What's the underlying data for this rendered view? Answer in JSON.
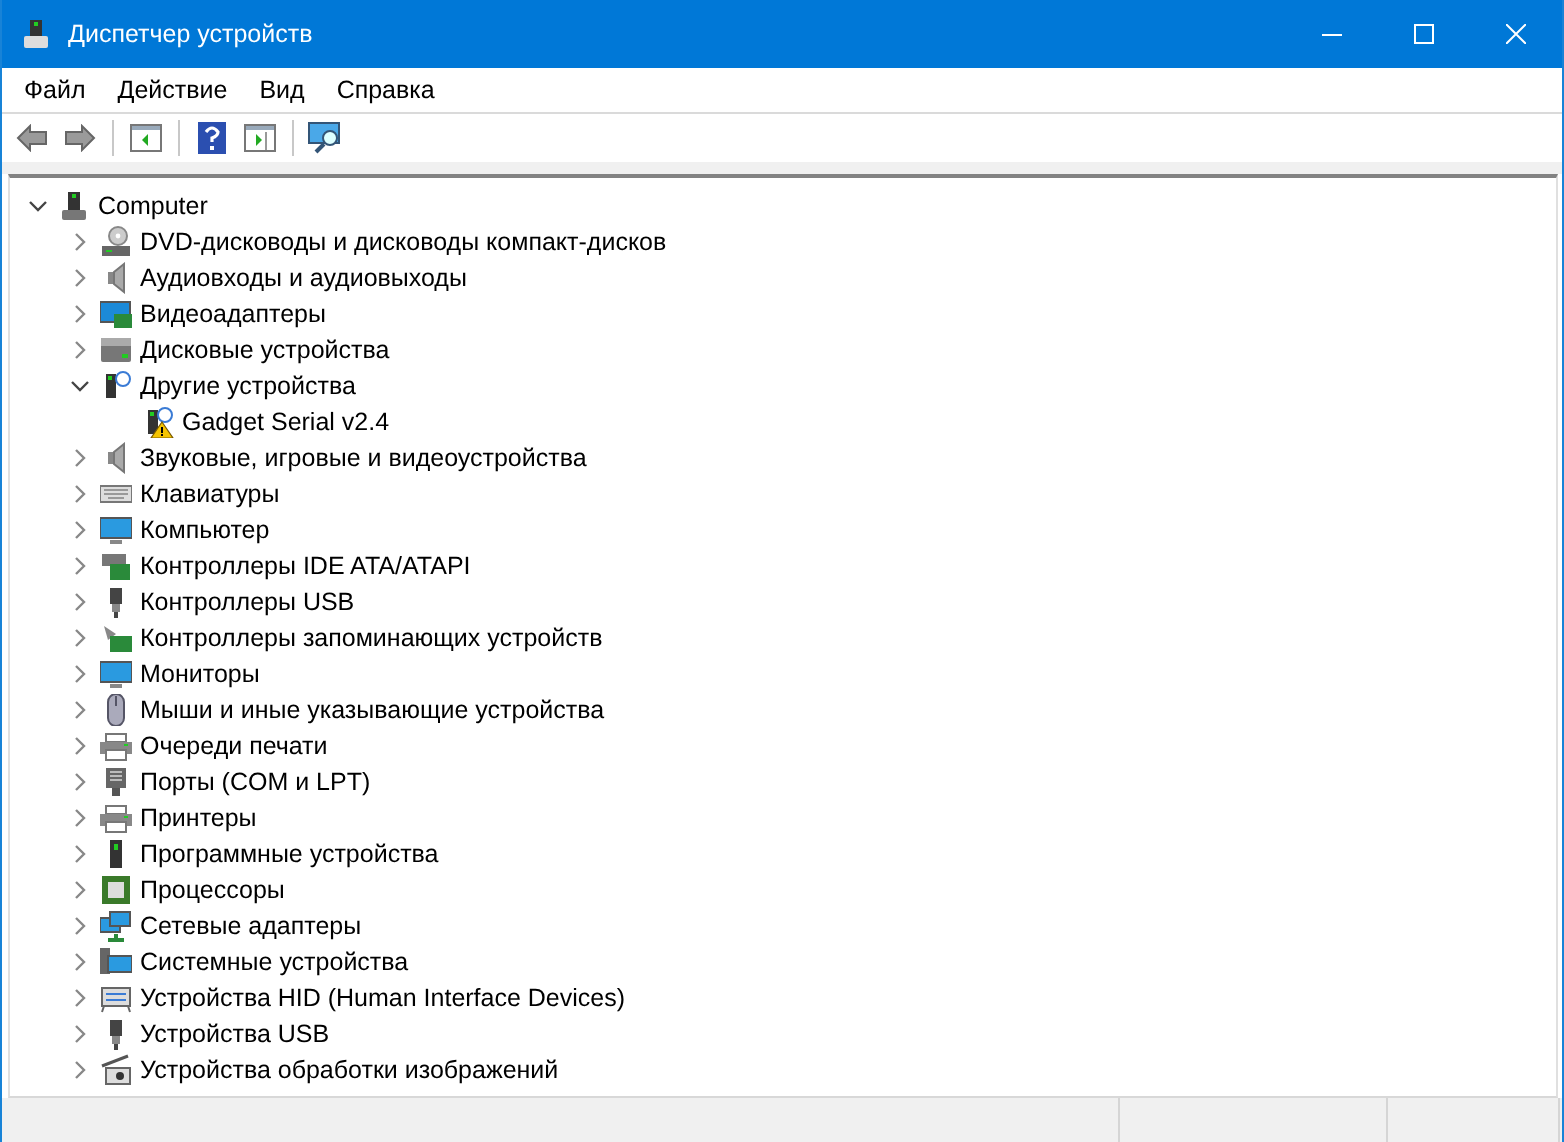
{
  "window": {
    "title": "Диспетчер устройств"
  },
  "menu": [
    "Файл",
    "Действие",
    "Вид",
    "Справка"
  ],
  "tree": {
    "label": "Computer",
    "kind": "computer-root",
    "expanded": true,
    "children": [
      {
        "label": "DVD-дисководы и дисководы компакт-дисков",
        "kind": "dvd",
        "expanded": false
      },
      {
        "label": "Аудиовходы и аудиовыходы",
        "kind": "speaker",
        "expanded": false
      },
      {
        "label": "Видеоадаптеры",
        "kind": "display-adapter",
        "expanded": false
      },
      {
        "label": "Дисковые устройства",
        "kind": "disk",
        "expanded": false
      },
      {
        "label": "Другие устройства",
        "kind": "unknown",
        "expanded": true,
        "children": [
          {
            "label": "Gadget Serial v2.4",
            "kind": "unknown",
            "problem": true
          }
        ]
      },
      {
        "label": "Звуковые, игровые и видеоустройства",
        "kind": "speaker",
        "expanded": false
      },
      {
        "label": "Клавиатуры",
        "kind": "keyboard",
        "expanded": false
      },
      {
        "label": "Компьютер",
        "kind": "monitor",
        "expanded": false
      },
      {
        "label": "Контроллеры IDE ATA/ATAPI",
        "kind": "controller",
        "expanded": false
      },
      {
        "label": "Контроллеры USB",
        "kind": "usb",
        "expanded": false
      },
      {
        "label": "Контроллеры запоминающих устройств",
        "kind": "storage",
        "expanded": false
      },
      {
        "label": "Мониторы",
        "kind": "monitor",
        "expanded": false
      },
      {
        "label": "Мыши и иные указывающие устройства",
        "kind": "mouse",
        "expanded": false
      },
      {
        "label": "Очереди печати",
        "kind": "printer",
        "expanded": false
      },
      {
        "label": "Порты (COM и LPT)",
        "kind": "port",
        "expanded": false
      },
      {
        "label": "Принтеры",
        "kind": "printer",
        "expanded": false
      },
      {
        "label": "Программные устройства",
        "kind": "software",
        "expanded": false
      },
      {
        "label": "Процессоры",
        "kind": "cpu",
        "expanded": false
      },
      {
        "label": "Сетевые адаптеры",
        "kind": "network",
        "expanded": false
      },
      {
        "label": "Системные устройства",
        "kind": "system",
        "expanded": false
      },
      {
        "label": "Устройства HID (Human Interface Devices)",
        "kind": "hid",
        "expanded": false
      },
      {
        "label": "Устройства USB",
        "kind": "usb",
        "expanded": false
      },
      {
        "label": "Устройства обработки изображений",
        "kind": "camera",
        "expanded": false
      }
    ]
  }
}
